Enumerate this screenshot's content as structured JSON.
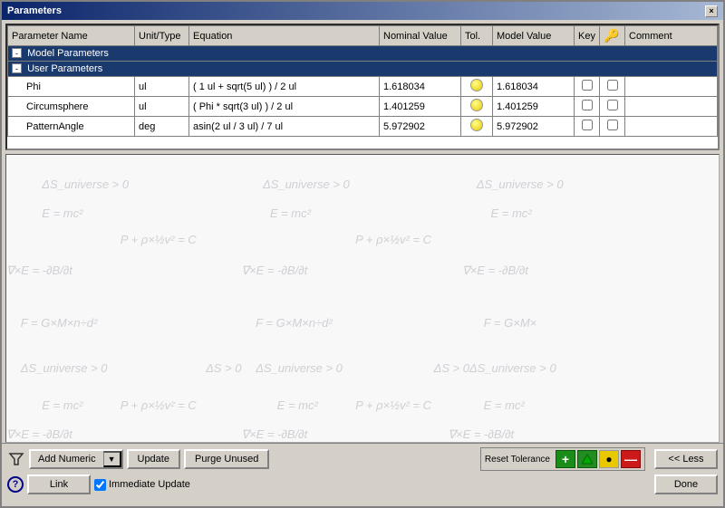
{
  "window": {
    "title": "Parameters",
    "close_label": "×"
  },
  "table": {
    "columns": [
      "Parameter Name",
      "Unit/Type",
      "Equation",
      "Nominal Value",
      "Tol.",
      "Model Value",
      "Key",
      "icon",
      "Comment"
    ],
    "rows": {
      "model_group": "Model Parameters",
      "user_group": "User Parameters",
      "params": [
        {
          "name": "Phi",
          "unit": "ul",
          "equation": "( 1 ul + sqrt(5 ul) ) / 2 ul",
          "nominal": "1.618034",
          "model_value": "1.618034"
        },
        {
          "name": "Circumsphere",
          "unit": "ul",
          "equation": "( Phi * sqrt(3 ul) ) / 2 ul",
          "nominal": "1.401259",
          "model_value": "1.401259"
        },
        {
          "name": "PatternAngle",
          "unit": "deg",
          "equation": "asin(2 ul / 3 ul) / 7 ul",
          "nominal": "5.972902",
          "model_value": "5.972902"
        }
      ]
    }
  },
  "bottom": {
    "add_numeric_label": "Add Numeric",
    "dropdown_arrow": "▼",
    "update_label": "Update",
    "purge_label": "Purge Unused",
    "link_label": "Link",
    "immediate_update_label": "Immediate Update",
    "reset_tolerance_label": "Reset Tolerance",
    "plus_label": "+",
    "minus_label": "—",
    "less_label": "<< Less",
    "done_label": "Done"
  },
  "math_expressions": [
    {
      "text": "E = mc²",
      "left": "5%",
      "top": "18%"
    },
    {
      "text": "∇×E = -∂B/∂t",
      "left": "0%",
      "top": "38%"
    },
    {
      "text": "ΔS_universe > 0",
      "left": "5%",
      "top": "8%"
    },
    {
      "text": "F = G×M×n÷d²",
      "left": "2%",
      "top": "56%"
    },
    {
      "text": "P + ρ×½v² = C",
      "left": "16%",
      "top": "27%"
    },
    {
      "text": "E = mc²",
      "left": "37%",
      "top": "18%"
    },
    {
      "text": "∇×E = -∂B/∂t",
      "left": "33%",
      "top": "38%"
    },
    {
      "text": "ΔS_universe > 0",
      "left": "36%",
      "top": "8%"
    },
    {
      "text": "F = G×M×n÷d²",
      "left": "35%",
      "top": "56%"
    },
    {
      "text": "P + ρ×½v² = C",
      "left": "49%",
      "top": "27%"
    },
    {
      "text": "E = mc²",
      "left": "68%",
      "top": "18%"
    },
    {
      "text": "∇×E = -∂B/∂t",
      "left": "64%",
      "top": "38%"
    },
    {
      "text": "ΔS_universe > 0",
      "left": "66%",
      "top": "8%"
    },
    {
      "text": "F = G×M×",
      "left": "67%",
      "top": "56%"
    },
    {
      "text": "ΔS_universe > 0",
      "left": "2%",
      "top": "72%"
    },
    {
      "text": "E = mc²",
      "left": "5%",
      "top": "85%"
    },
    {
      "text": "∇×E = -∂B/∂t",
      "left": "0%",
      "top": "95%"
    },
    {
      "text": "P + ρ×½v² = C",
      "left": "16%",
      "top": "85%"
    },
    {
      "text": "ΔS_universe > 0",
      "left": "35%",
      "top": "72%"
    },
    {
      "text": "E = mc²",
      "left": "38%",
      "top": "85%"
    },
    {
      "text": "∇×E = -∂B/∂t",
      "left": "33%",
      "top": "95%"
    },
    {
      "text": "P + ρ×½v² = C",
      "left": "49%",
      "top": "85%"
    },
    {
      "text": "ΔS_universe > 0",
      "left": "65%",
      "top": "72%"
    },
    {
      "text": "E = mc²",
      "left": "67%",
      "top": "85%"
    },
    {
      "text": "∇×E = -∂B/∂t",
      "left": "62%",
      "top": "95%"
    },
    {
      "text": "ΔS > 0",
      "left": "28%",
      "top": "72%"
    },
    {
      "text": "ΔS > 0",
      "left": "60%",
      "top": "72%"
    }
  ]
}
